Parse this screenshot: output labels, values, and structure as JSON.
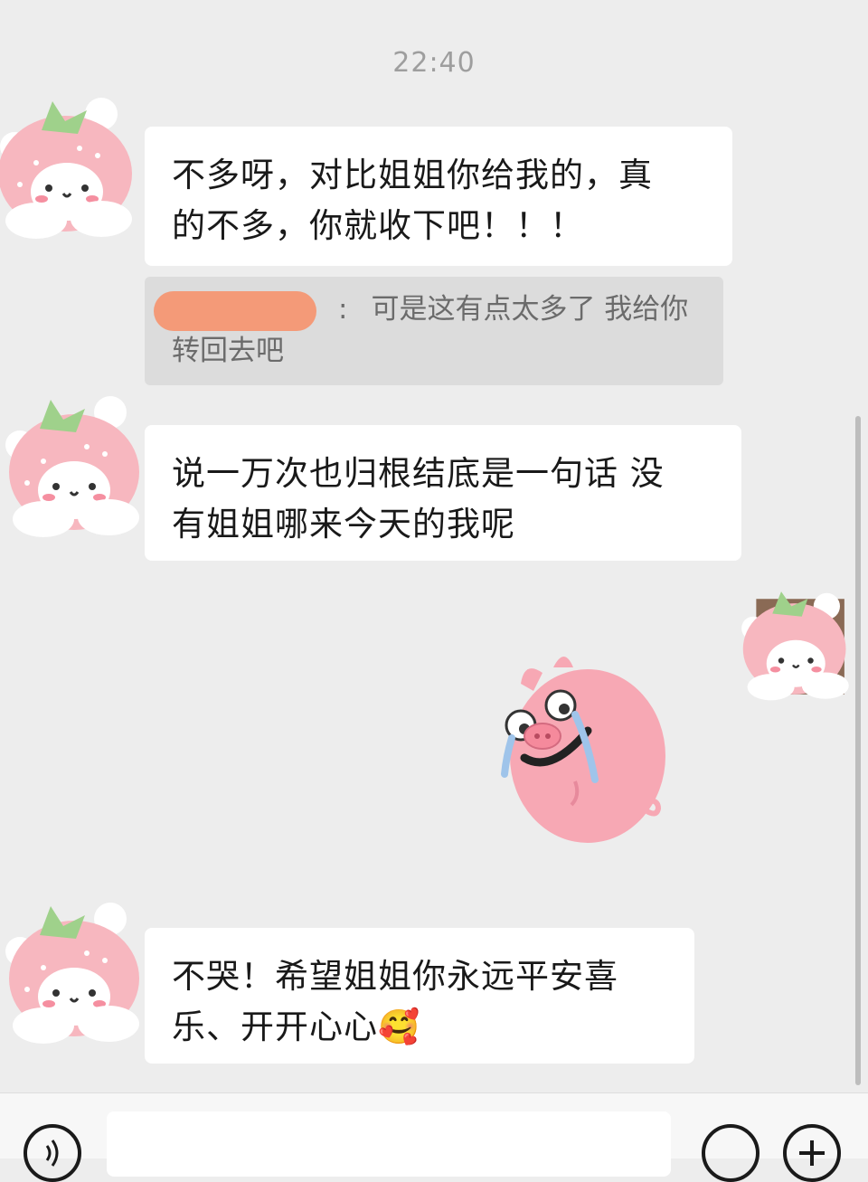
{
  "chat": {
    "timestamp": "22:40",
    "messages": [
      {
        "sender": "contact",
        "text_line1": "不多呀，对比姐姐你给我的，真",
        "text_line2": "的不多，你就收下吧！！！"
      },
      {
        "sender": "contact",
        "text_line1": "说一万次也归根结底是一句话 没",
        "text_line2": "有姐姐哪来今天的我呢"
      },
      {
        "sender": "self",
        "type": "sticker",
        "sticker_icon": "crying-pig-sticker-icon"
      },
      {
        "sender": "contact",
        "text_line1": "不哭！希望姐姐你永远平安喜",
        "text_line2": "乐、开开心心",
        "emoji": "🥰"
      }
    ],
    "quote": {
      "separator": ":",
      "text_line1": "可是这有点太多了 我给你",
      "text_line2": "转回去吧"
    }
  },
  "input_bar": {
    "voice_icon": "voice-icon",
    "emoji_icon": "emoji-icon",
    "plus_icon": "plus-icon"
  },
  "colors": {
    "background": "#ededed",
    "bubble": "#ffffff",
    "quote_bg": "#dcdcdc",
    "redaction": "#f49a78",
    "avatar_pink": "#f7b7bf",
    "leaf_green": "#9fd18b"
  }
}
